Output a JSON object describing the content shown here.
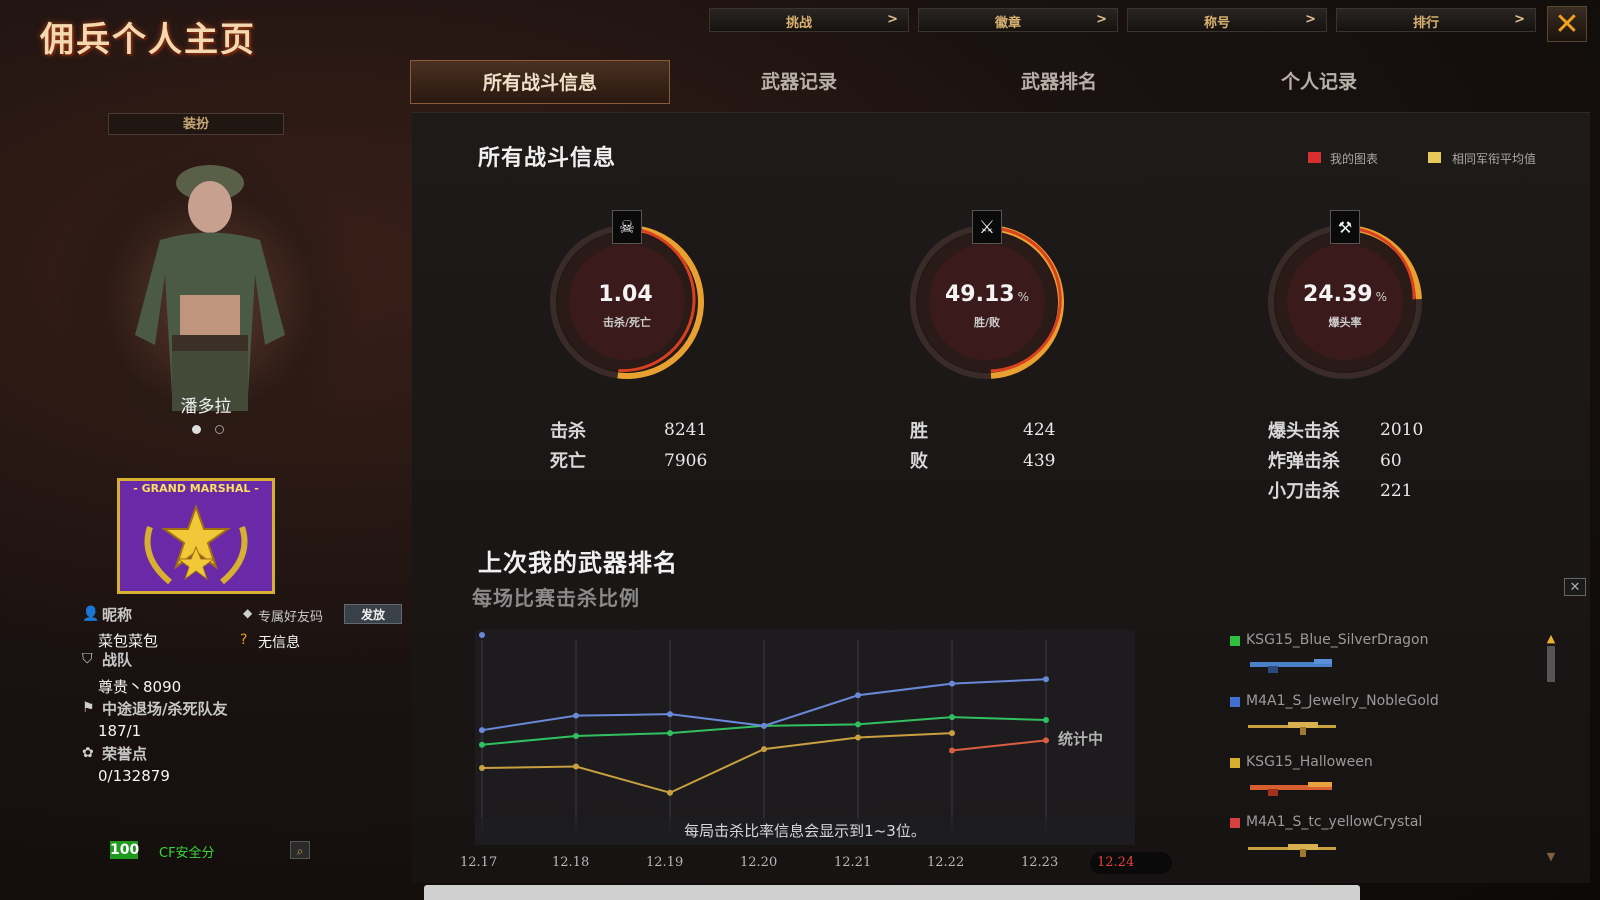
{
  "page_title": "佣兵个人主页",
  "top_nav": [
    {
      "label": "挑战",
      "arrow": ">"
    },
    {
      "label": "徽章",
      "arrow": ">"
    },
    {
      "label": "称号",
      "arrow": ">"
    },
    {
      "label": "排行",
      "arrow": ">"
    }
  ],
  "close_label": "✕",
  "tabs": [
    "所有战斗信息",
    "武器记录",
    "武器排名",
    "个人记录"
  ],
  "left": {
    "outfit_button": "装扮",
    "character_name": "潘多拉",
    "rank_badge_text": "- GRAND MARSHAL -",
    "nickname_label": "昵称",
    "nickname": "菜包菜包",
    "friend_code_label": "专属好友码",
    "fire_button": "发放",
    "friend_code_value": "无信息",
    "team_label": "战队",
    "team": "尊贵丶8090",
    "quit_label": "中途退场/杀死队友",
    "quit_value": "187/1",
    "honor_label": "荣誉点",
    "honor_value": "0/132879",
    "safe_score": "100",
    "safe_label": "CF安全分"
  },
  "main": {
    "section_title": "所有战斗信息",
    "legend": [
      {
        "label": "我的图表",
        "color": "#d83030"
      },
      {
        "label": "相同军衔平均值",
        "color": "#e8c858"
      }
    ],
    "gauges": [
      {
        "value": "1.04",
        "pct": "",
        "sub": "击杀/死亡",
        "fill": 0.52,
        "icon": "skull-icon"
      },
      {
        "value": "49.13",
        "pct": "%",
        "sub": "胜/败",
        "fill": 0.4913,
        "icon": "crossed-swords-icon"
      },
      {
        "value": "24.39",
        "pct": "%",
        "sub": "爆头率",
        "fill": 0.2439,
        "icon": "knife-icon"
      }
    ],
    "stats": {
      "kills_label": "击杀",
      "kills": "8241",
      "deaths_label": "死亡",
      "deaths": "7906",
      "wins_label": "胜",
      "wins": "424",
      "losses_label": "败",
      "losses": "439",
      "headshot_label": "爆头击杀",
      "headshot": "2010",
      "bomb_label": "炸弹击杀",
      "bomb": "60",
      "knife_label": "小刀击杀",
      "knife": "221"
    },
    "weapon_rank_title": "上次我的武器排名",
    "chart_subtitle": "每场比赛击杀比例",
    "chart_status": "统计中",
    "chart_note": "每局击杀比率信息会显示到1~3位。",
    "weapons": [
      {
        "name": "KSG15_Blue_SilverDragon",
        "color": "#30c040"
      },
      {
        "name": "M4A1_S_Jewelry_NobleGold",
        "color": "#4070d0"
      },
      {
        "name": "KSG15_Halloween",
        "color": "#d8b030"
      },
      {
        "name": "M4A1_S_tc_yellowCrystal",
        "color": "#d84040"
      }
    ]
  },
  "chart_data": {
    "type": "line",
    "categories": [
      "12.17",
      "12.18",
      "12.19",
      "12.20",
      "12.21",
      "12.22",
      "12.23",
      "12.24"
    ],
    "active_category": "12.24",
    "series": [
      {
        "name": "KSG15_Blue_SilverDragon",
        "color": "#30c060",
        "values": [
          0.28,
          0.34,
          0.36,
          0.41,
          0.42,
          0.47,
          0.45,
          null
        ]
      },
      {
        "name": "M4A1_S_Jewelry_NobleGold",
        "color": "#6a88d8",
        "values": [
          0.38,
          0.48,
          0.49,
          0.41,
          0.62,
          0.7,
          0.73,
          null
        ]
      },
      {
        "name": "KSG15_Halloween",
        "color": "#c8a040",
        "values": [
          0.12,
          0.13,
          -0.05,
          0.25,
          0.33,
          0.36,
          null,
          null
        ]
      },
      {
        "name": "M4A1_S_tc_yellowCrystal",
        "color": "#d86040",
        "values": [
          null,
          null,
          null,
          null,
          null,
          0.24,
          0.31,
          null
        ]
      }
    ],
    "extra_point": {
      "category": "12.17",
      "value": 1.0,
      "color": "#6a88d8"
    },
    "grid": true
  }
}
